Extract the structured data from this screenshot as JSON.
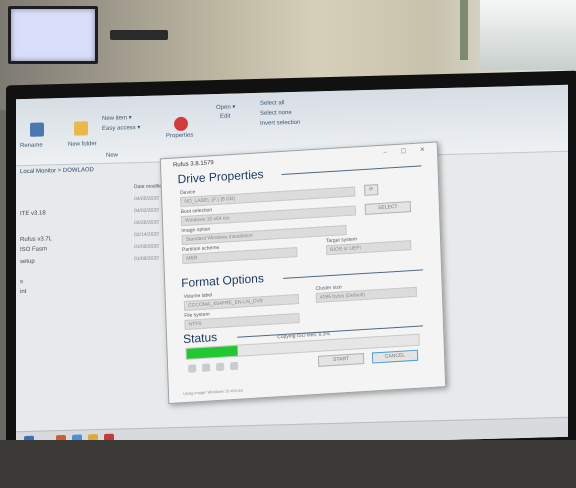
{
  "explorer": {
    "tabs": [
      "Rename",
      "New folder",
      "New"
    ],
    "ribbon_labels": [
      "New item ▾",
      "Easy access ▾",
      "Open ▾",
      "Edit",
      "Properties",
      "Select all",
      "Select none",
      "Invert selection"
    ],
    "breadcrumb": "Local Monitor > DOWLAOD",
    "column_header": "Date modified",
    "files": [
      {
        "name": "ITE v3.18",
        "date": "04/05/2020"
      },
      {
        "name": "Rufus v3.7L",
        "date": "04/02/2020"
      },
      {
        "name": "ISO Fasm",
        "date": "03/26/2020"
      },
      {
        "name": "setup",
        "date": "02/14/2020"
      },
      {
        "name": "s",
        "date": "01/09/2020"
      },
      {
        "name": "int",
        "date": "01/09/2020"
      }
    ]
  },
  "dialog": {
    "title": "Rufus 3.8.1579",
    "drive_properties": "Drive Properties",
    "device_label": "Device",
    "device_value": "NO_LABEL (F:) [8 GB]",
    "boot_selection_label": "Boot selection",
    "boot_selection_value": "Windows 10 x64.iso",
    "image_option_label": "Image option",
    "image_option_value": "Standard Windows installation",
    "partition_scheme_label": "Partition scheme",
    "partition_scheme_value": "MBR",
    "target_system_label": "Target system",
    "target_system_value": "BIOS or UEFI",
    "select_button": "SELECT",
    "format_options": "Format Options",
    "volume_label_label": "Volume label",
    "volume_label_value": "CCCOMA_X64FRE_EN-US_DV9",
    "file_system_label": "File system",
    "file_system_value": "NTFS",
    "cluster_size_label": "Cluster size",
    "cluster_size_value": "4096 bytes (Default)",
    "status": "Status",
    "status_text": "Copying ISO files: 6.3%",
    "progress_fraction": 0.22,
    "start_button": "START",
    "cancel_button": "CANCEL",
    "footer": "Using image: Windows 10 x64.iso"
  },
  "colors": {
    "progress": "#22c832",
    "section": "#1e3c60"
  }
}
